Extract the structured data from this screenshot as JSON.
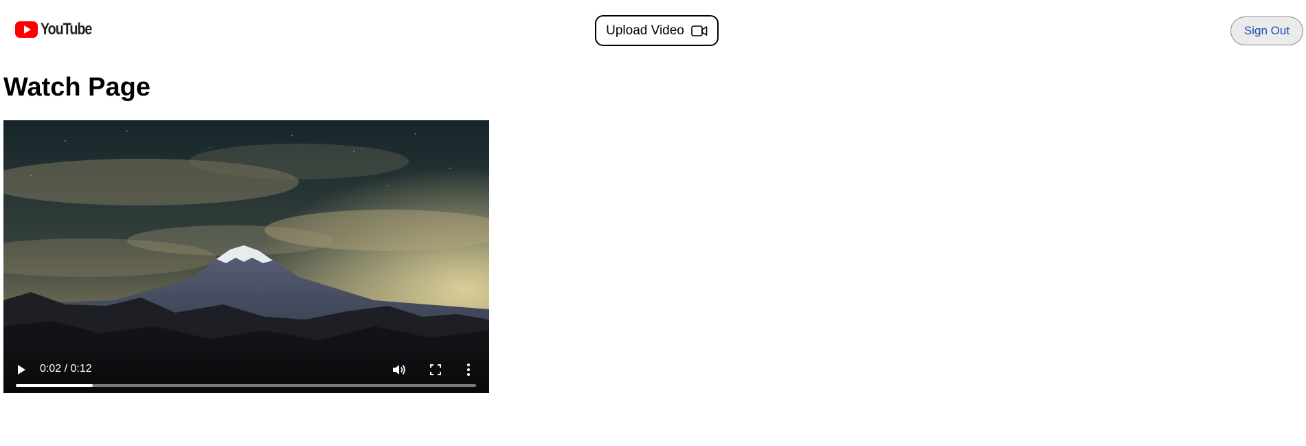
{
  "header": {
    "logo_text": "YouTube",
    "upload_label": "Upload Video",
    "signout_label": "Sign Out"
  },
  "page": {
    "title": "Watch Page"
  },
  "player": {
    "time_display": "0:02 / 0:12",
    "progress_fraction": 0.167,
    "controls": [
      "play-icon",
      "volume-icon",
      "fullscreen-icon",
      "more-options-icon"
    ]
  },
  "colors": {
    "brand_red": "#ff0000",
    "signout_text": "#1a4fb5",
    "signout_bg": "#ebebeb"
  }
}
